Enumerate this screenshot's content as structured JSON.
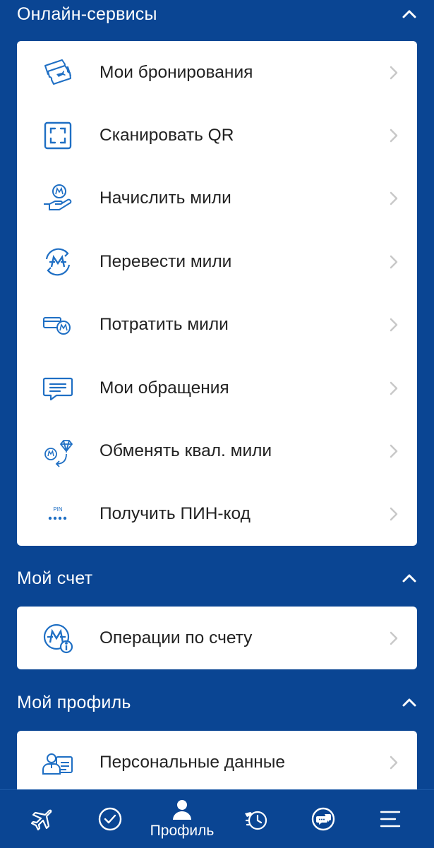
{
  "sections": {
    "online": {
      "title": "Онлайн-сервисы",
      "items": [
        {
          "label": "Мои бронирования",
          "icon": "tickets-icon"
        },
        {
          "label": "Сканировать QR",
          "icon": "qr-scan-icon"
        },
        {
          "label": "Начислить мили",
          "icon": "accrue-miles-icon"
        },
        {
          "label": "Перевести мили",
          "icon": "transfer-miles-icon"
        },
        {
          "label": "Потратить мили",
          "icon": "spend-miles-icon"
        },
        {
          "label": "Мои обращения",
          "icon": "chat-message-icon"
        },
        {
          "label": "Обменять квал. мили",
          "icon": "exchange-miles-icon"
        },
        {
          "label": "Получить ПИН-код",
          "icon": "pin-code-icon"
        }
      ]
    },
    "account": {
      "title": "Мой счет",
      "items": [
        {
          "label": "Операции по счету",
          "icon": "account-operations-icon"
        }
      ]
    },
    "profile": {
      "title": "Мой профиль",
      "items": [
        {
          "label": "Персональные данные",
          "icon": "personal-data-icon"
        }
      ]
    }
  },
  "pin_badge": "PIN",
  "tabbar": {
    "active": "Профиль",
    "tabs": [
      {
        "name": "flights",
        "icon": "airplane-icon"
      },
      {
        "name": "checkin",
        "icon": "check-circle-icon"
      },
      {
        "name": "profile",
        "icon": "person-icon",
        "label": "Профиль"
      },
      {
        "name": "history",
        "icon": "history-icon"
      },
      {
        "name": "chat",
        "icon": "chat-bubbles-icon"
      },
      {
        "name": "menu",
        "icon": "menu-icon"
      }
    ]
  },
  "colors": {
    "background": "#0a4593",
    "icon_blue": "#1f6fc4",
    "chevron": "#c8c8c8"
  }
}
